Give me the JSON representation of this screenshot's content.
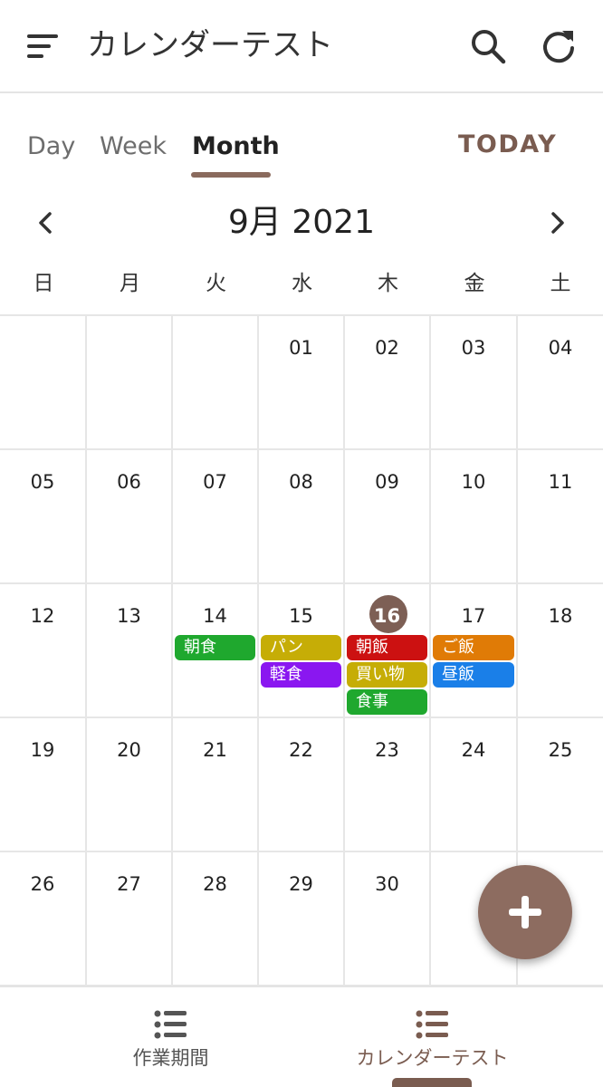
{
  "appbar": {
    "title": "カレンダーテスト",
    "icons": [
      "menu-icon",
      "search-icon",
      "refresh-icon"
    ]
  },
  "tabs": [
    {
      "label": "Day",
      "active": false
    },
    {
      "label": "Week",
      "active": false
    },
    {
      "label": "Month",
      "active": true
    }
  ],
  "today_label": "TODAY",
  "month_label": "9月 2021",
  "weekdays": [
    "日",
    "月",
    "火",
    "水",
    "木",
    "金",
    "土"
  ],
  "weeks": [
    [
      "",
      "",
      "",
      "01",
      "02",
      "03",
      "04"
    ],
    [
      "05",
      "06",
      "07",
      "08",
      "09",
      "10",
      "11"
    ],
    [
      "12",
      "13",
      "14",
      "15",
      "16",
      "17",
      "18"
    ],
    [
      "19",
      "20",
      "21",
      "22",
      "23",
      "24",
      "25"
    ],
    [
      "26",
      "27",
      "28",
      "29",
      "30",
      "",
      ""
    ]
  ],
  "today_day": "16",
  "events": [
    {
      "day": "14",
      "title": "朝食",
      "color": "#1fa82e"
    },
    {
      "day": "15",
      "title": "パン",
      "color": "#c6ad06"
    },
    {
      "day": "15",
      "title": "軽食",
      "color": "#8a17f0"
    },
    {
      "day": "16",
      "title": "朝飯",
      "color": "#cc1111"
    },
    {
      "day": "16",
      "title": "買い物",
      "color": "#c6ad06"
    },
    {
      "day": "16",
      "title": "食事",
      "color": "#1fa82e"
    },
    {
      "day": "17",
      "title": "ご飯",
      "color": "#e07b06"
    },
    {
      "day": "17",
      "title": "昼飯",
      "color": "#1a7fe8"
    }
  ],
  "bottom_nav": [
    {
      "label": "作業期間",
      "icon": "list-icon",
      "active": false
    },
    {
      "label": "カレンダーテスト",
      "icon": "list-icon",
      "active": true
    }
  ],
  "colors": {
    "accent": "#7a5c50",
    "fab": "#8d6c60",
    "today_circle": "#7d5f55"
  }
}
